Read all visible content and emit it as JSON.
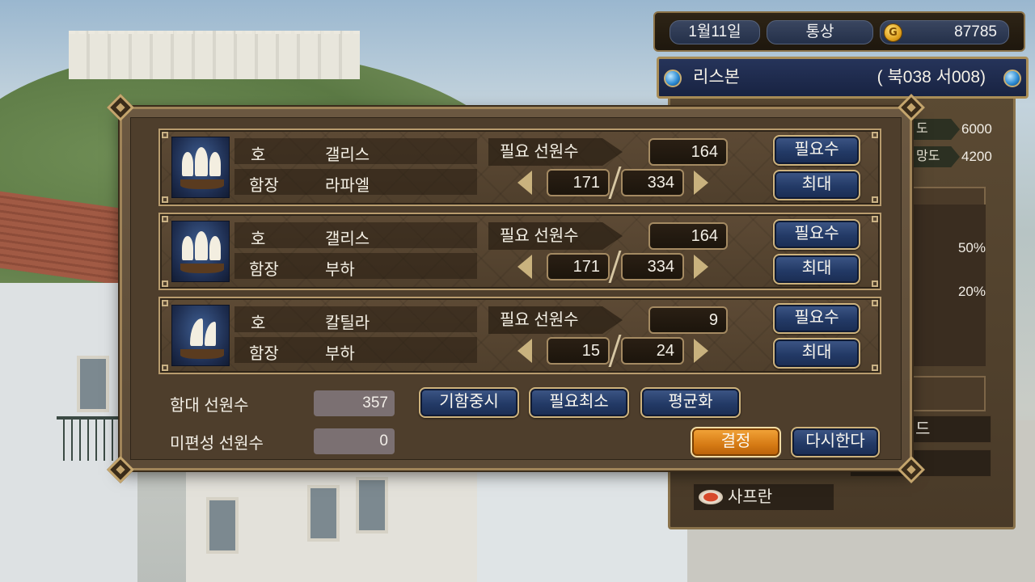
{
  "hud": {
    "date": "1월11일",
    "mode": "통상",
    "coin_glyph": "G",
    "gold": "87785"
  },
  "city": {
    "name": "리스본",
    "coords": "( 북038  서008)"
  },
  "side_panel": {
    "stat1_tag": "도",
    "stat1_value": "6000",
    "stat2_tag": "망도",
    "stat2_value": "4200",
    "pct1": "50%",
    "pct2": "20%",
    "slot_text": "드",
    "item_label": "사프란"
  },
  "ships": [
    {
      "name_label": "호",
      "name": "갤리스",
      "captain_label": "함장",
      "captain": "라파엘",
      "req_label": "필요 선원수",
      "required": "164",
      "current": "171",
      "max": "334",
      "btn_required": "필요수",
      "btn_max": "최대"
    },
    {
      "name_label": "호",
      "name": "갤리스",
      "captain_label": "함장",
      "captain": "부하",
      "req_label": "필요 선원수",
      "required": "164",
      "current": "171",
      "max": "334",
      "btn_required": "필요수",
      "btn_max": "최대"
    },
    {
      "name_label": "호",
      "name": "칼틸라",
      "captain_label": "함장",
      "captain": "부하",
      "req_label": "필요 선원수",
      "required": "9",
      "current": "15",
      "max": "24",
      "btn_required": "필요수",
      "btn_max": "최대"
    }
  ],
  "footer": {
    "fleet_crew_label": "함대 선원수",
    "fleet_crew_value": "357",
    "unassigned_label": "미편성 선원수",
    "unassigned_value": "0",
    "btn_flagship": "기함중시",
    "btn_min": "필요최소",
    "btn_even": "평균화",
    "btn_confirm": "결정",
    "btn_reset": "다시한다"
  },
  "colors": {
    "panel": "#5b4a36",
    "button_blue": "#233a66",
    "button_gold": "#d57a14",
    "trim": "#b89c6e"
  }
}
